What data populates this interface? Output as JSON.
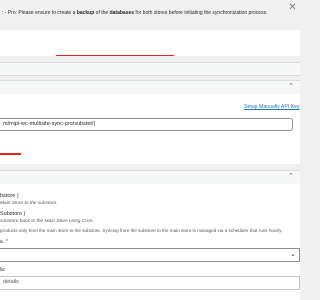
{
  "notice": {
    "prefix": ": - Pro: Please ensure to create a ",
    "backup": "backup",
    "mid": " of the ",
    "databases": "databases",
    "suffix": " for both stores before initiating the synchronization process."
  },
  "connection": {
    "setup_link": "Setup Manually API Key",
    "url_value": "m/mipl-wc-multisite-sync-pro/substet/)"
  },
  "sync_settings": {
    "option1_title": "bstore )",
    "option1_desc": "Main Store to the substore.",
    "option2_title": "Substore )",
    "option2_desc": "substore back to the Main Store using Cron.",
    "info_text": "products only from the main store to the substore. Syncing from the substore to the main store is managed via a scheduler that runs hourly.",
    "field1_label": "s. ",
    "field1_required": "*",
    "field2_label": "ls:",
    "field2_value": "details"
  },
  "icons": {
    "dismiss": "close-icon",
    "collapse": "chevron-up-icon",
    "dropdown": "chevron-down-icon"
  },
  "colors": {
    "accent_red": "#e0261f",
    "link": "#2271b1",
    "required": "#d63638"
  }
}
